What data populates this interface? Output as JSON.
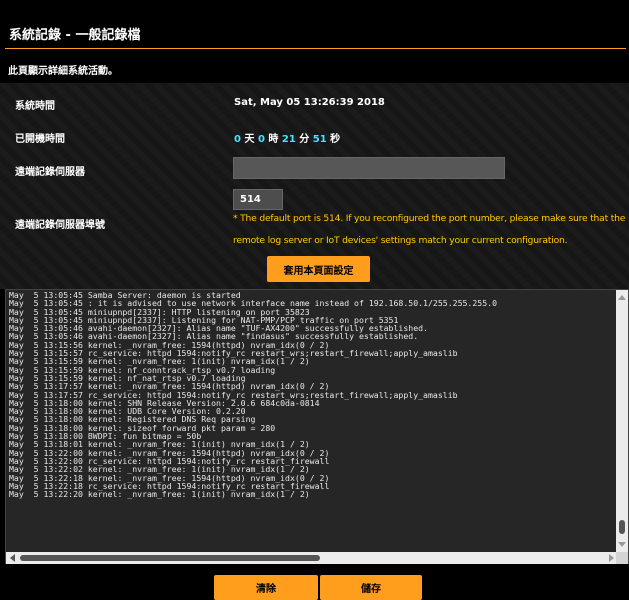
{
  "page": {
    "title": "系統記錄 - 一般記錄檔",
    "description": "此頁顯示詳細系統活動。"
  },
  "colors": {
    "accent": "#ff9d1c",
    "highlight": "#4ee0ff",
    "hint": "#ffcc00",
    "background": "#000000"
  },
  "settings": {
    "system_time_label": "系統時間",
    "system_time_value": "Sat, May 05 13:26:39 2018",
    "uptime_label": "已開機時間",
    "uptime": {
      "days": "0",
      "days_unit": "天",
      "hours": "0",
      "hours_unit": "時",
      "minutes": "21",
      "minutes_unit": "分",
      "seconds": "51",
      "seconds_unit": "秒"
    },
    "remote_log_server_label": "遠端記錄伺服器",
    "remote_log_server_value": "",
    "remote_log_port_label": "遠端記錄伺服器埠號",
    "remote_log_port_value": "514",
    "port_hint_line1": "* The default port is 514. If you reconfigured the port number, please make sure that the",
    "port_hint_line2": "remote log server or IoT devices' settings match your current configuration.",
    "apply_button": "套用本頁面設定"
  },
  "log": {
    "lines": [
      "May  5 13:05:45 Samba Server: daemon is started",
      "May  5 13:05:45 : it is advised to use network interface name instead of 192.168.50.1/255.255.255.0",
      "May  5 13:05:45 miniupnpd[2337]: HTTP listening on port 35823",
      "May  5 13:05:45 miniupnpd[2337]: Listening for NAT-PMP/PCP traffic on port 5351",
      "May  5 13:05:46 avahi-daemon[2327]: Alias name \"TUF-AX4200\" successfully established.",
      "May  5 13:05:46 avahi-daemon[2327]: Alias name \"findasus\" successfully established.",
      "May  5 13:15:56 kernel: _nvram_free: 1594(httpd) nvram_idx(0 / 2)",
      "May  5 13:15:57 rc_service: httpd 1594:notify_rc restart_wrs;restart_firewall;apply_amaslib",
      "May  5 13:15:59 kernel: _nvram_free: 1(init) nvram_idx(1 / 2)",
      "May  5 13:15:59 kernel: nf_conntrack_rtsp v0.7 loading",
      "May  5 13:15:59 kernel: nf_nat_rtsp v0.7 loading",
      "May  5 13:17:57 kernel: _nvram_free: 1594(httpd) nvram_idx(0 / 2)",
      "May  5 13:17:57 rc_service: httpd 1594:notify_rc restart_wrs;restart_firewall;apply_amaslib",
      "May  5 13:18:00 kernel: SHN Release Version: 2.0.6 684c0da-0814",
      "May  5 13:18:00 kernel: UDB Core Version: 0.2.20",
      "May  5 13:18:00 kernel: Registered DNS Req parsing",
      "May  5 13:18:00 kernel: sizeof forward pkt param = 280",
      "May  5 13:18:00 BWDPI: fun bitmap = 50b",
      "May  5 13:18:01 kernel: _nvram_free: 1(init) nvram_idx(1 / 2)",
      "May  5 13:22:00 kernel: _nvram_free: 1594(httpd) nvram_idx(0 / 2)",
      "May  5 13:22:00 rc_service: httpd 1594:notify_rc restart_firewall",
      "May  5 13:22:02 kernel: _nvram_free: 1(init) nvram_idx(1 / 2)",
      "May  5 13:22:18 kernel: _nvram_free: 1594(httpd) nvram_idx(0 / 2)",
      "May  5 13:22:18 rc_service: httpd 1594:notify_rc restart_firewall",
      "May  5 13:22:20 kernel: _nvram_free: 1(init) nvram_idx(1 / 2)"
    ]
  },
  "footer": {
    "clear_button": "清除",
    "save_button": "儲存"
  }
}
